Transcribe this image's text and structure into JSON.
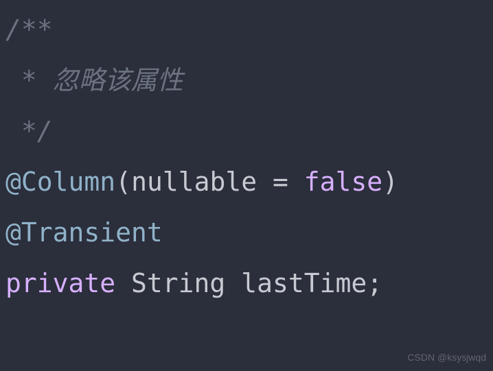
{
  "code": {
    "line1": {
      "text": "/**"
    },
    "line2": {
      "prefix": " * ",
      "comment": "忽略该属性"
    },
    "line3": {
      "text": " */"
    },
    "line4": {
      "at": "@",
      "annoName": "Column",
      "lparen": "(",
      "param": "nullable",
      "space1": " ",
      "eq": "=",
      "space2": " ",
      "value": "false",
      "rparen": ")"
    },
    "line5": {
      "at": "@",
      "annoName": "Transient"
    },
    "line6": {
      "modifier": "private",
      "space1": " ",
      "type": "String",
      "space2": " ",
      "name": "lastTime",
      "semi": ";"
    }
  },
  "watermark": "CSDN @ksysjwqd"
}
